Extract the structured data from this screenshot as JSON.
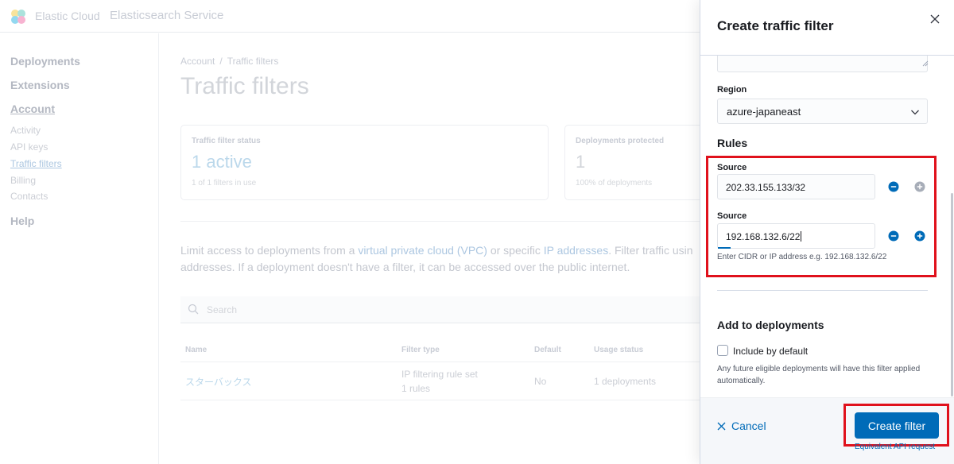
{
  "topbar": {
    "brand": "Elastic Cloud",
    "service": "Elasticsearch Service"
  },
  "sidebar": {
    "sections": [
      "Deployments",
      "Extensions",
      "Account",
      "Help"
    ],
    "account_items": [
      "Activity",
      "API keys",
      "Traffic filters",
      "Billing",
      "Contacts"
    ],
    "active_item": "Traffic filters"
  },
  "breadcrumb": [
    "Account",
    "Traffic filters"
  ],
  "page": {
    "title": "Traffic filters",
    "cards": [
      {
        "label": "Traffic filter status",
        "value": "1 active",
        "sub": "1 of 1 filters in use"
      },
      {
        "label": "Deployments protected",
        "value": "1",
        "sub": "100% of deployments"
      }
    ],
    "description": {
      "part1": "Limit access to deployments from a ",
      "link1": "virtual private cloud (VPC)",
      "part2": " or specific ",
      "link2": "IP addresses",
      "part3": ". Filter traffic usin",
      "line2": "addresses. If a deployment doesn't have a filter, it can be accessed over the public internet."
    },
    "search_placeholder": "Search",
    "table": {
      "headers": [
        "Name",
        "Filter type",
        "Default",
        "Usage status"
      ],
      "rows": [
        {
          "name": "スターバックス",
          "type": "IP filtering rule set",
          "type_sub": "1 rules",
          "default": "No",
          "usage": "1 deployments"
        }
      ]
    }
  },
  "flyout": {
    "title": "Create traffic filter",
    "region_label": "Region",
    "region_value": "azure-japaneast",
    "rules_heading": "Rules",
    "sources": [
      {
        "label": "Source",
        "value": "202.33.155.133/32"
      },
      {
        "label": "Source",
        "value": "192.168.132.6/22"
      }
    ],
    "source_help": "Enter CIDR or IP address e.g. 192.168.132.6/22",
    "deployments_heading": "Add to deployments",
    "include_default_label": "Include by default",
    "include_default_checked": false,
    "include_default_help": "Any future eligible deployments will have this filter applied automatically.",
    "cancel_label": "Cancel",
    "create_label": "Create filter",
    "api_link": "Equivalent API request"
  },
  "colors": {
    "primary": "#006bb8",
    "highlight": "#e0111c",
    "remove": "#006bb8",
    "add_disabled": "#98a2b3"
  }
}
